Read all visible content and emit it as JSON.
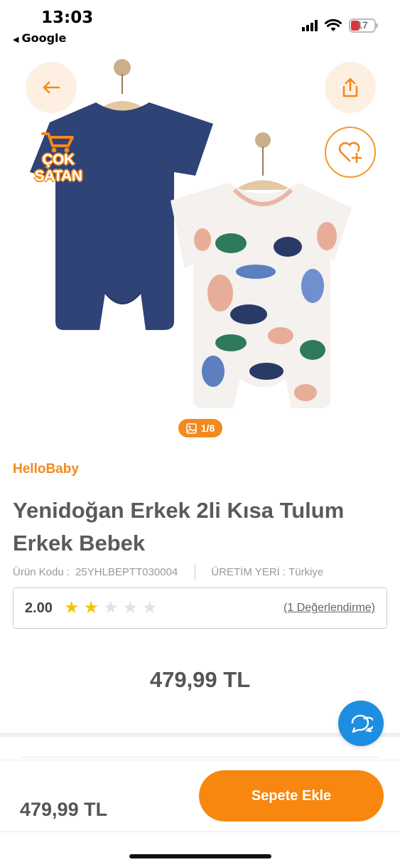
{
  "status_bar": {
    "time": "13:03",
    "back_app": "Google",
    "battery": "17"
  },
  "hero": {
    "badge_line1": "ÇOK",
    "badge_line2": "SATAN",
    "image_counter": "1/8"
  },
  "product": {
    "brand": "HelloBaby",
    "title": "Yenidoğan Erkek 2li Kısa Tulum Erkek Bebek",
    "code_label": "Ürün Kodu :",
    "code_value": "25YHLBEPTT030004",
    "origin_label": "ÜRETİM YERİ :",
    "origin_value": "Türkiye",
    "rating": "2.00",
    "rating_value": 2,
    "rating_max": 5,
    "reviews_link": "(1 Değerlendirme)",
    "price": "479,99 TL"
  },
  "bottom_bar": {
    "price": "479,99 TL",
    "add_to_cart": "Sepete Ekle"
  },
  "colors": {
    "accent": "#f28a1e",
    "chat": "#1e8ee0",
    "star": "#f5c400"
  },
  "icons": {
    "back": "arrow-left-icon",
    "share": "share-icon",
    "favorite": "heart-plus-icon",
    "gallery": "image-icon",
    "chat": "chat-bubbles-icon",
    "cart": "shopping-cart-icon"
  }
}
